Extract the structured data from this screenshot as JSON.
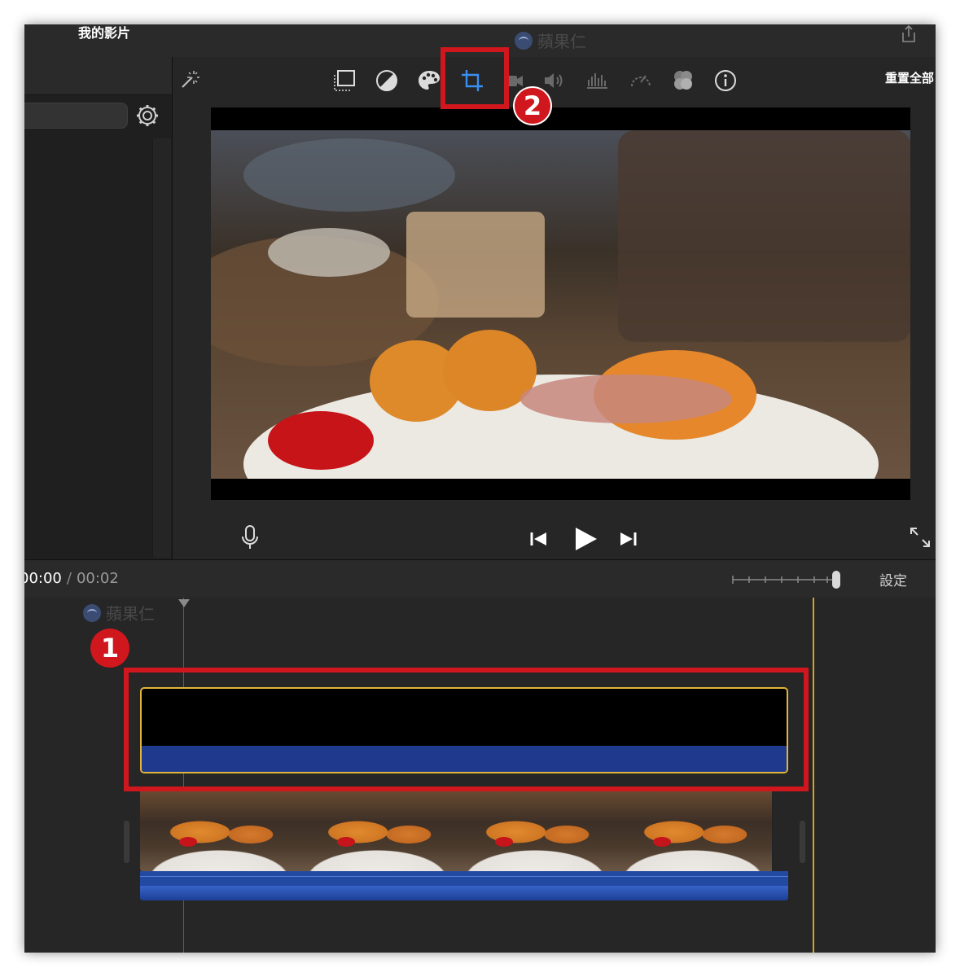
{
  "window": {
    "title": "我的影片",
    "watermark": "蘋果仁"
  },
  "toolbar": {
    "icons": [
      "magic-wand-icon",
      "crop-fit-icon",
      "color-balance-icon",
      "palette-icon",
      "crop-icon",
      "camera-stabilize-icon",
      "volume-icon",
      "equalizer-icon",
      "speed-icon",
      "overlay-icon",
      "info-icon"
    ],
    "reset_label": "重置全部"
  },
  "playback": {
    "current_time": "00:00",
    "separator": "/",
    "duration": "00:02"
  },
  "timeline": {
    "settings_label": "設定",
    "watermark": "蘋果仁"
  },
  "annotations": {
    "step1": "1",
    "step2": "2"
  },
  "colors": {
    "annotation_red": "#d0171d",
    "clip_border": "#e2b43a",
    "audio_blue": "#234aa3",
    "end_marker": "#d9a321"
  }
}
